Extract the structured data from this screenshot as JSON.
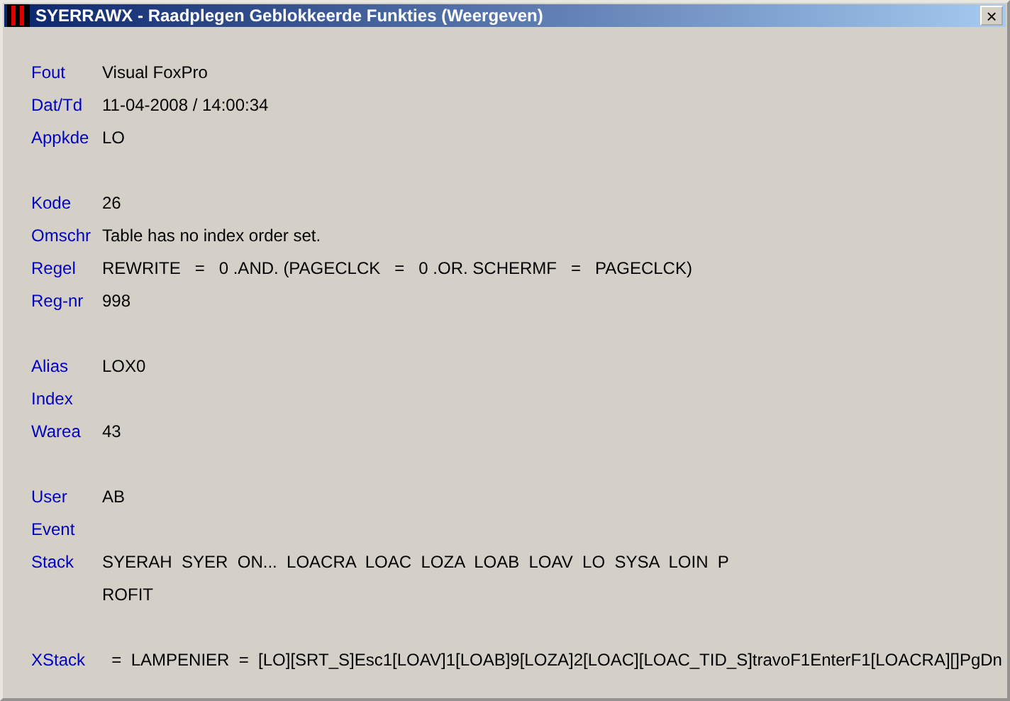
{
  "window": {
    "title": "SYERRAWX - Raadplegen Geblokkeerde Funkties (Weergeven)",
    "close": "×"
  },
  "groups": [
    {
      "fields": [
        {
          "label": "Fout",
          "lines": [
            "Visual FoxPro"
          ]
        },
        {
          "label": "Dat/Td",
          "lines": [
            "11-04-2008 / 14:00:34"
          ]
        },
        {
          "label": "Appkde",
          "lines": [
            "LO"
          ]
        }
      ]
    },
    {
      "fields": [
        {
          "label": "Kode",
          "lines": [
            "26"
          ]
        },
        {
          "label": "Omschr",
          "lines": [
            "Table has no index order set."
          ]
        },
        {
          "label": "Regel",
          "lines": [
            "REWRITE   =   0 .AND. (PAGECLCK   =   0 .OR. SCHERMF   =   PAGECLCK)"
          ]
        },
        {
          "label": "Reg-nr",
          "lines": [
            "998"
          ]
        }
      ]
    },
    {
      "fields": [
        {
          "label": "Alias",
          "lines": [
            "LOX0"
          ]
        },
        {
          "label": "Index"
        },
        {
          "label": "Warea",
          "lines": [
            "43"
          ]
        }
      ]
    },
    {
      "fields": [
        {
          "label": "User",
          "lines": [
            "AB"
          ]
        },
        {
          "label": "Event"
        },
        {
          "label": "Stack",
          "lines": [
            "SYERAH  SYER  ON...  LOACRA  LOAC  LOZA  LOAB  LOAV  LO  SYSA  LOIN  P",
            "ROFIT"
          ]
        }
      ]
    },
    {
      "fields": [
        {
          "label": "XStack",
          "lines": [
            "  =  LAMPENIER  =  [LO][SRT_S]Esc1[LOAV]1[LOAB]9[LOZA]2[LOAC][LOAC_TID_S]travoF1EnterF1[LOACRA][]PgDn"
          ]
        }
      ]
    }
  ]
}
